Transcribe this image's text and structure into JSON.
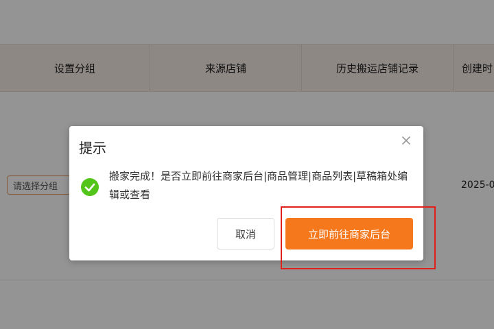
{
  "table": {
    "columns": [
      "设置分组",
      "来源店铺",
      "历史搬运店铺记录",
      "创建时"
    ]
  },
  "row": {
    "group_select_placeholder": "请选择分组",
    "created_date": "2025-0"
  },
  "dialog": {
    "title": "提示",
    "message": "搬家完成！是否立即前往商家后台|商品管理|商品列表|草稿箱处编辑或查看",
    "cancel_label": "取消",
    "confirm_label": "立即前往商家后台"
  },
  "colors": {
    "accent": "#f6781d",
    "success": "#52c41a",
    "highlight": "#e0201c"
  },
  "icons": {
    "close": "close-icon",
    "success": "check-circle-icon"
  }
}
